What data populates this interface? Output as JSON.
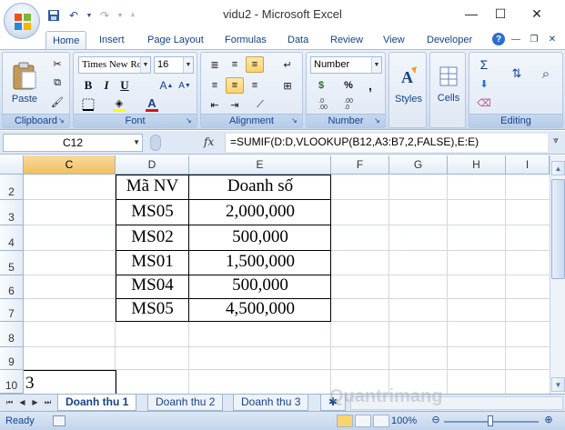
{
  "window": {
    "title": "vidu2 - Microsoft Excel"
  },
  "ribbon_tabs": [
    "Home",
    "Insert",
    "Page Layout",
    "Formulas",
    "Data",
    "Review",
    "View",
    "Developer"
  ],
  "clipboard": {
    "paste_label": "Paste",
    "group_label": "Clipboard"
  },
  "font": {
    "name": "Times New Ro",
    "size": "16",
    "bold": "B",
    "italic": "I",
    "underline": "U",
    "font_color_glyph": "A",
    "group_label": "Font"
  },
  "alignment": {
    "group_label": "Alignment"
  },
  "number": {
    "format": "Number",
    "currency": "$",
    "percent": "%",
    "comma": ",",
    "group_label": "Number"
  },
  "styles": {
    "label": "Styles"
  },
  "cells": {
    "label": "Cells"
  },
  "editing": {
    "sum_glyph": "Σ",
    "group_label": "Editing"
  },
  "formula_bar": {
    "name_box": "C12",
    "fx": "fx",
    "formula": "=SUMIF(D:D,VLOOKUP(B12,A3:B7,2,FALSE),E:E)"
  },
  "columns": [
    "C",
    "D",
    "E",
    "F",
    "G",
    "H",
    "I"
  ],
  "rows": [
    "2",
    "3",
    "4",
    "5",
    "6",
    "7",
    "8",
    "9",
    "10"
  ],
  "table": {
    "header": {
      "code": "Mã NV",
      "sales": "Doanh số"
    },
    "rows": [
      {
        "code": "MS05",
        "sales": "2,000,000"
      },
      {
        "code": "MS02",
        "sales": "500,000"
      },
      {
        "code": "MS01",
        "sales": "1,500,000"
      },
      {
        "code": "MS04",
        "sales": "500,000"
      },
      {
        "code": "MS05",
        "sales": "4,500,000"
      }
    ]
  },
  "c10_value": "3",
  "sheets": [
    "Doanh thu 1",
    "Doanh thu 2",
    "Doanh thu 3"
  ],
  "active_sheet_index": 0,
  "status": {
    "text": "Ready",
    "zoom": "100%"
  },
  "colors": {
    "accent": "#15428b",
    "ribbon_bg": "#dbe6f4",
    "selected_header": "#f1c15f"
  }
}
